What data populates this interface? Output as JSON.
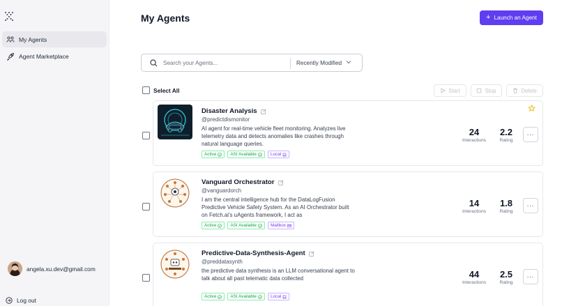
{
  "sidebar": {
    "items": [
      {
        "label": "My Agents"
      },
      {
        "label": "Agent Marketplace"
      }
    ],
    "user_email": "angela.xu.dev@gmail.com",
    "logout_label": "Log out"
  },
  "header": {
    "title": "My Agents",
    "launch_label": "Launch an Agent"
  },
  "search": {
    "placeholder": "Search your Agents...",
    "value": "",
    "sort_label": "Recently Modified"
  },
  "bulk": {
    "select_all_label": "Select All",
    "start_label": "Start",
    "stop_label": "Stop",
    "delete_label": "Delete"
  },
  "agents": [
    {
      "name": "Disaster Analysis",
      "handle": "@predictdismonitor",
      "description": "AI agent for real-time vehicle fleet monitoring. Analyzes live telemetry data and detects anomalies like crashes through natural language queries.",
      "tags": [
        "Active",
        "ASI Available",
        "Local"
      ],
      "interactions": "24",
      "interactions_label": "Interactions",
      "rating": "2.2",
      "rating_label": "Rating",
      "starred": true
    },
    {
      "name": "Vanguard Orchestrator",
      "handle": "@vanguardorch",
      "description": "I am the central intelligence hub for the DataLogFusion Predictive Vehicle Safety System. As an AI Orchestrator built on Fetch.ai's uAgents framework, I act as",
      "tags": [
        "Active",
        "ASI Available",
        "Mailbox"
      ],
      "interactions": "14",
      "interactions_label": "Interactions",
      "rating": "1.8",
      "rating_label": "Rating",
      "starred": false
    },
    {
      "name": "Predictive-Data-Synthesis-Agent",
      "handle": "@preddatasynth",
      "description": "the predictive data synthesis is an LLM conversational agent to talk about all past telematic data collected",
      "tags": [
        "Active",
        "ASI Available",
        "Local"
      ],
      "interactions": "44",
      "interactions_label": "Interactions",
      "rating": "2.5",
      "rating_label": "Rating",
      "starred": false
    }
  ],
  "colors": {
    "brand": "#5f3df0",
    "tag_green": "#16a34a",
    "tag_purple": "#7c3aed",
    "star": "#eab308"
  }
}
